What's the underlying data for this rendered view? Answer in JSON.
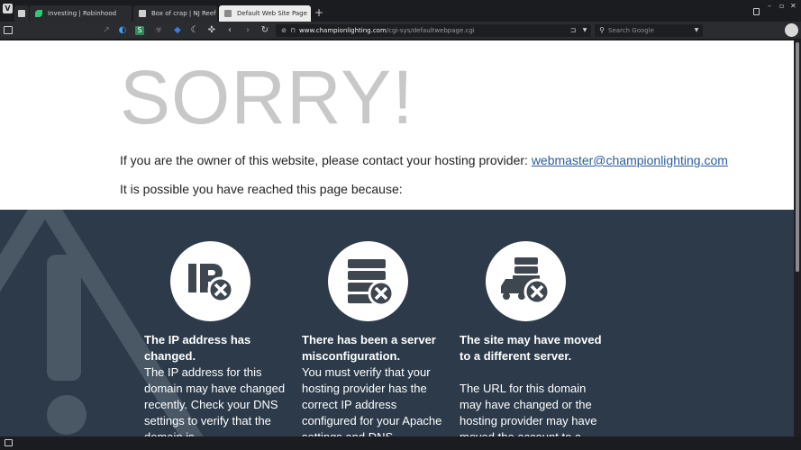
{
  "browser": {
    "tabs": [
      {
        "title": "Investing | Robinhood",
        "icon_color": "#2ecc71"
      },
      {
        "title": "Box of crap | NJ Reef Club",
        "icon_color": "#d0d0d0"
      },
      {
        "title": "Default Web Site Page",
        "icon_color": "#8a8a8a",
        "active": true
      }
    ],
    "new_tab_label": "+",
    "url_domain": "www.championlighting.com",
    "url_path": "/cgi-sys/defaultwebpage.cgi",
    "search_placeholder": "Search Google"
  },
  "page": {
    "heading": "SORRY!",
    "owner_text": "If you are the owner of this website, please contact your hosting provider: ",
    "contact_email": "webmaster@championlighting.com",
    "reached_text": "It is possible you have reached this page because:",
    "reasons": [
      {
        "title": "The IP address has changed.",
        "description": "The IP address for this domain may have changed recently. Check your DNS settings to verify that the domain is"
      },
      {
        "title": "There has been a server misconfiguration.",
        "description": "You must verify that your hosting provider has the correct IP address configured for your Apache settings and DNS"
      },
      {
        "title": "The site may have moved to a different server.",
        "description": "The URL for this domain may have changed or the hosting provider may have moved the account to a"
      }
    ]
  },
  "colors": {
    "dark_panel": "#2c3a4a",
    "heading": "#c8c8c8",
    "link": "#2a5d9f",
    "icon_dark": "#3e4650"
  }
}
